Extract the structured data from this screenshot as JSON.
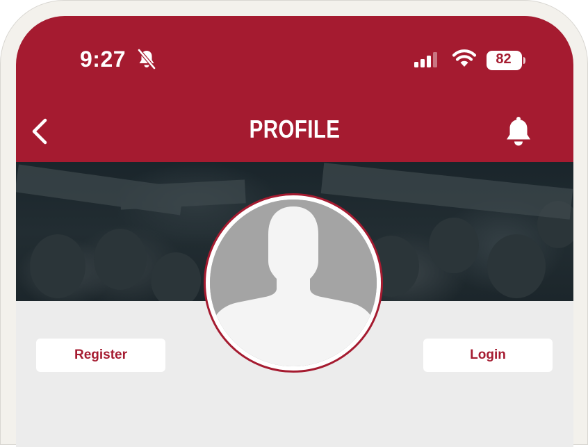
{
  "status_bar": {
    "time": "9:27",
    "battery_level": "82",
    "icons": [
      "bell-slash-icon",
      "cellular-signal-icon",
      "wifi-icon",
      "battery-icon"
    ]
  },
  "header": {
    "title": "PROFILE",
    "back_icon": "chevron-left-icon",
    "notification_icon": "bell-icon"
  },
  "profile": {
    "avatar_icon": "default-avatar-silhouette"
  },
  "actions": {
    "register_label": "Register",
    "login_label": "Login"
  },
  "colors": {
    "brand_red": "#a51b30",
    "surface": "#ececec",
    "button_bg": "#ffffff"
  }
}
